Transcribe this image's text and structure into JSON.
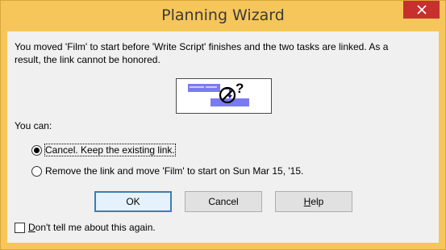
{
  "window": {
    "title": "Planning Wizard",
    "accent": "#f7c65a",
    "close_color": "#c7302d"
  },
  "message": {
    "line1": "You moved 'Film' to start before 'Write Script' finishes and the two tasks are linked.  As a",
    "line2": "result, the link cannot be honored."
  },
  "illustration": {
    "icon": "link-conflict-icon",
    "glyph": "?"
  },
  "options": {
    "prompt": "You can:",
    "items": [
      {
        "label": "Cancel.  Keep the existing link.",
        "selected": true
      },
      {
        "label": "Remove the link and move 'Film' to start on Sun Mar 15, '15.",
        "selected": false
      }
    ]
  },
  "buttons": {
    "ok": "OK",
    "cancel": "Cancel",
    "help_prefix": "",
    "help_mnemonic": "H",
    "help_rest": "elp"
  },
  "checkbox": {
    "mnemonic": "D",
    "rest": "on't tell me about this again.",
    "checked": false
  }
}
